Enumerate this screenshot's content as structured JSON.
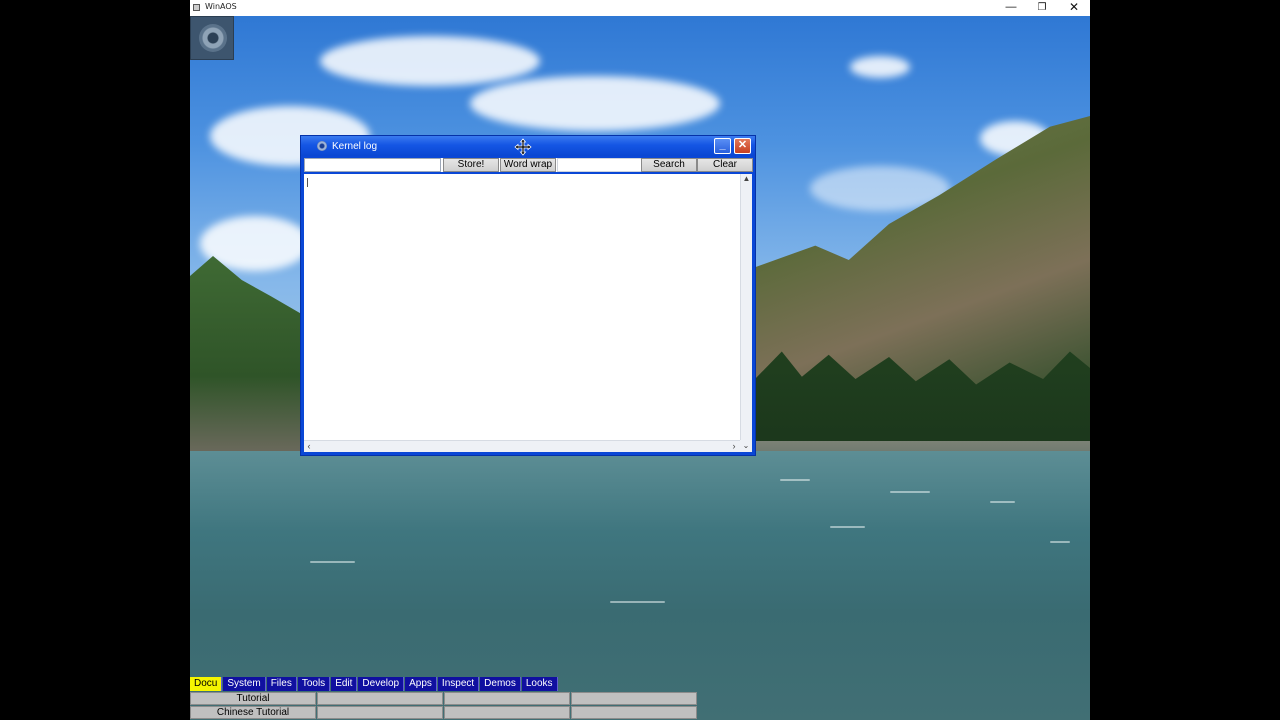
{
  "host_window": {
    "title": "WinAOS",
    "icons": {
      "app": "app-icon",
      "minimize": "minimize-icon",
      "restore": "restore-icon",
      "close": "close-icon"
    }
  },
  "desktop": {
    "icon_name": "gear-icon"
  },
  "kernel_log": {
    "title": "Kernel log",
    "icon": "gear-icon",
    "toolbar": {
      "store_label": "Store!",
      "word_wrap_label": "Word wrap",
      "search_label": "Search",
      "clear_label": "Clear",
      "filter_value": "",
      "search_value": ""
    },
    "log_text": "",
    "colors": {
      "title_bar": "#0a46d2",
      "close_button": "#c74021"
    }
  },
  "taskbar": {
    "menus": [
      {
        "label": "Docu",
        "active": true
      },
      {
        "label": "System",
        "active": false
      },
      {
        "label": "Files",
        "active": false
      },
      {
        "label": "Tools",
        "active": false
      },
      {
        "label": "Edit",
        "active": false
      },
      {
        "label": "Develop",
        "active": false
      },
      {
        "label": "Apps",
        "active": false
      },
      {
        "label": "Inspect",
        "active": false
      },
      {
        "label": "Demos",
        "active": false
      },
      {
        "label": "Looks",
        "active": false
      }
    ],
    "rows": [
      [
        "Tutorial",
        "",
        "",
        ""
      ],
      [
        "Chinese Tutorial",
        "",
        "",
        ""
      ]
    ],
    "colors": {
      "menu_bg": "#1010a0",
      "active_bg": "#f5f500"
    }
  }
}
